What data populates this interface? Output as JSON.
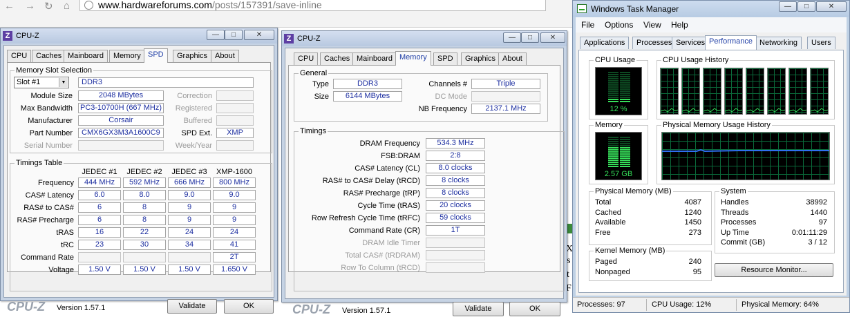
{
  "browser": {
    "url_host": "www.hardwareforums.com",
    "url_path": "/posts/157391/save-inline"
  },
  "page_glimpse": [
    "X",
    "s",
    "t",
    "F"
  ],
  "cpuz_spd": {
    "title": "CPU-Z",
    "tabs": [
      "CPU",
      "Caches",
      "Mainboard",
      "Memory",
      "SPD",
      "Graphics",
      "About"
    ],
    "active_tab": "SPD",
    "slot_group_title": "Memory Slot Selection",
    "slot_selected": "Slot #1",
    "memory_type": "DDR3",
    "fields": [
      {
        "label": "Module Size",
        "value": "2048 MBytes"
      },
      {
        "label": "Max Bandwidth",
        "value": "PC3-10700H (667 MHz)"
      },
      {
        "label": "Manufacturer",
        "value": "Corsair"
      },
      {
        "label": "Part Number",
        "value": "CMX6GX3M3A1600C9"
      },
      {
        "label": "Serial Number",
        "value": ""
      }
    ],
    "right_fields": [
      {
        "label": "Correction",
        "value": ""
      },
      {
        "label": "Registered",
        "value": ""
      },
      {
        "label": "Buffered",
        "value": ""
      },
      {
        "label": "SPD Ext.",
        "value": "XMP"
      },
      {
        "label": "Week/Year",
        "value": ""
      }
    ],
    "timings_title": "Timings Table",
    "timing_columns": [
      "JEDEC #1",
      "JEDEC #2",
      "JEDEC #3",
      "XMP-1600"
    ],
    "timing_rows": [
      {
        "label": "Frequency",
        "values": [
          "444 MHz",
          "592 MHz",
          "666 MHz",
          "800 MHz"
        ]
      },
      {
        "label": "CAS# Latency",
        "values": [
          "6.0",
          "8.0",
          "9.0",
          "9.0"
        ]
      },
      {
        "label": "RAS# to CAS#",
        "values": [
          "6",
          "8",
          "9",
          "9"
        ]
      },
      {
        "label": "RAS# Precharge",
        "values": [
          "6",
          "8",
          "9",
          "9"
        ]
      },
      {
        "label": "tRAS",
        "values": [
          "16",
          "22",
          "24",
          "24"
        ]
      },
      {
        "label": "tRC",
        "values": [
          "23",
          "30",
          "34",
          "41"
        ]
      },
      {
        "label": "Command Rate",
        "values": [
          "",
          "",
          "",
          "2T"
        ]
      },
      {
        "label": "Voltage",
        "values": [
          "1.50 V",
          "1.50 V",
          "1.50 V",
          "1.650 V"
        ]
      }
    ],
    "logo": "CPU-Z",
    "version": "Version 1.57.1",
    "validate_label": "Validate",
    "ok_label": "OK"
  },
  "cpuz_mem": {
    "title": "CPU-Z",
    "tabs": [
      "CPU",
      "Caches",
      "Mainboard",
      "Memory",
      "SPD",
      "Graphics",
      "About"
    ],
    "active_tab": "Memory",
    "general_title": "General",
    "type_label": "Type",
    "type_value": "DDR3",
    "size_label": "Size",
    "size_value": "6144 MBytes",
    "channels_label": "Channels #",
    "channels_value": "Triple",
    "dc_label": "DC Mode",
    "dc_value": "",
    "nb_label": "NB Frequency",
    "nb_value": "2137.1 MHz",
    "timings_title": "Timings",
    "timings": [
      {
        "label": "DRAM Frequency",
        "value": "534.3 MHz",
        "dim": false
      },
      {
        "label": "FSB:DRAM",
        "value": "2:8",
        "dim": false
      },
      {
        "label": "CAS# Latency (CL)",
        "value": "8.0 clocks",
        "dim": false
      },
      {
        "label": "RAS# to CAS# Delay (tRCD)",
        "value": "8 clocks",
        "dim": false
      },
      {
        "label": "RAS# Precharge (tRP)",
        "value": "8 clocks",
        "dim": false
      },
      {
        "label": "Cycle Time (tRAS)",
        "value": "20 clocks",
        "dim": false
      },
      {
        "label": "Row Refresh Cycle Time (tRFC)",
        "value": "59 clocks",
        "dim": false
      },
      {
        "label": "Command Rate (CR)",
        "value": "1T",
        "dim": false
      },
      {
        "label": "DRAM Idle Timer",
        "value": "",
        "dim": true
      },
      {
        "label": "Total CAS# (tRDRAM)",
        "value": "",
        "dim": true
      },
      {
        "label": "Row To Column (tRCD)",
        "value": "",
        "dim": true
      }
    ],
    "logo": "CPU-Z",
    "version": "Version 1.57.1",
    "validate_label": "Validate",
    "ok_label": "OK"
  },
  "taskmgr": {
    "title": "Windows Task Manager",
    "menus": [
      "File",
      "Options",
      "View",
      "Help"
    ],
    "tabs": [
      "Applications",
      "Processes",
      "Services",
      "Performance",
      "Networking",
      "Users"
    ],
    "active_tab": "Performance",
    "cpu_usage_title": "CPU Usage",
    "cpu_usage_value": "12 %",
    "cpu_usage_level": 0.12,
    "cpu_history_title": "CPU Usage History",
    "memory_title": "Memory",
    "memory_value": "2.57 GB",
    "memory_level": 0.64,
    "phys_history_title": "Physical Memory Usage History",
    "physical_title": "Physical Memory (MB)",
    "physical": [
      {
        "label": "Total",
        "value": "4087"
      },
      {
        "label": "Cached",
        "value": "1240"
      },
      {
        "label": "Available",
        "value": "1450"
      },
      {
        "label": "Free",
        "value": "273"
      }
    ],
    "kernel_title": "Kernel Memory (MB)",
    "kernel": [
      {
        "label": "Paged",
        "value": "240"
      },
      {
        "label": "Nonpaged",
        "value": "95"
      }
    ],
    "system_title": "System",
    "system": [
      {
        "label": "Handles",
        "value": "38992"
      },
      {
        "label": "Threads",
        "value": "1440"
      },
      {
        "label": "Processes",
        "value": "97"
      },
      {
        "label": "Up Time",
        "value": "0:01:11:29"
      },
      {
        "label": "Commit (GB)",
        "value": "3 / 12"
      }
    ],
    "resource_monitor_label": "Resource Monitor...",
    "status_processes": "Processes: 97",
    "status_cpu": "CPU Usage: 12%",
    "status_memory": "Physical Memory: 64%",
    "colors": {
      "graph_green": "#36e05a",
      "graph_grid": "#0a6a3a",
      "memory_line": "#2f6ff0"
    }
  }
}
